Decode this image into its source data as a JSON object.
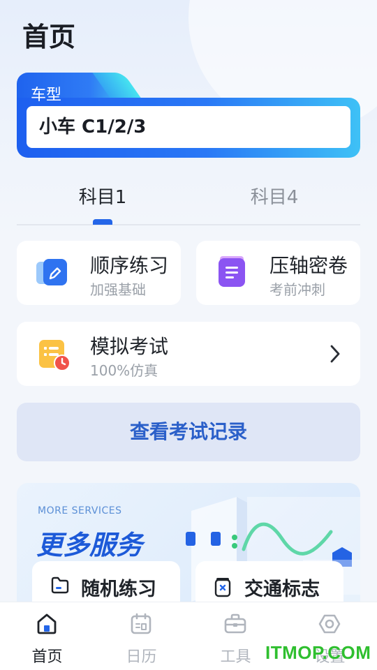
{
  "header": {
    "title": "首页"
  },
  "vehicle": {
    "label": "车型",
    "value": "小车 C1/2/3"
  },
  "subject_tabs": [
    {
      "label": "科目1",
      "active": true
    },
    {
      "label": "科目4",
      "active": false
    }
  ],
  "features": {
    "sequential": {
      "title": "顺序练习",
      "subtitle": "加强基础",
      "icon": "pencil-icon"
    },
    "final": {
      "title": "压轴密卷",
      "subtitle": "考前冲刺",
      "icon": "document-icon"
    },
    "mock": {
      "title": "模拟考试",
      "subtitle": "100%仿真",
      "icon": "exam-clock-icon"
    }
  },
  "record_button": {
    "label": "查看考试记录"
  },
  "services": {
    "eyebrow": "MORE SERVICES",
    "heading": "更多服务",
    "items": [
      {
        "label": "随机练习",
        "icon": "folder-icon"
      },
      {
        "label": "交通标志",
        "icon": "sign-icon"
      }
    ]
  },
  "bottom_nav": [
    {
      "label": "首页",
      "icon": "home-icon",
      "active": true
    },
    {
      "label": "日历",
      "icon": "calendar-icon",
      "active": false
    },
    {
      "label": "工具",
      "icon": "toolbox-icon",
      "active": false
    },
    {
      "label": "设置",
      "icon": "settings-icon",
      "active": false
    }
  ],
  "watermark": "ITMOP.COM",
  "colors": {
    "primary": "#2466e8",
    "record_text": "#2a5fc9",
    "record_bg": "#dfe6f6",
    "watermark": "#2fbf2f"
  }
}
